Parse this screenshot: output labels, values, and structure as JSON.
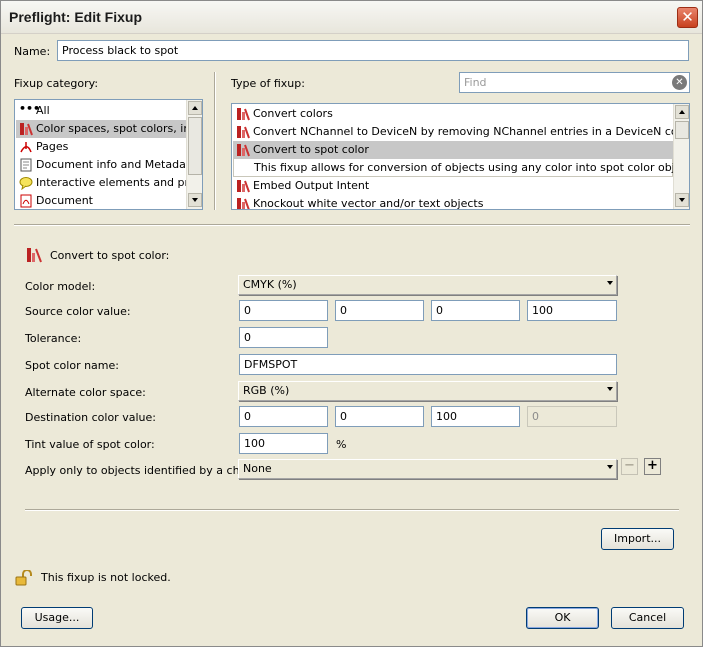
{
  "window": {
    "title": "Preflight: Edit Fixup",
    "close_label": "✕"
  },
  "name_field": {
    "label": "Name:",
    "value": "Process black to spot"
  },
  "fixup_category": {
    "label": "Fixup category:",
    "items": [
      {
        "label": "All",
        "icon": "ellipsis-icon"
      },
      {
        "label": "Color spaces, spot colors, inks",
        "icon": "color-spaces-icon"
      },
      {
        "label": "Pages",
        "icon": "pdf-icon"
      },
      {
        "label": "Document info and Metadata",
        "icon": "document-info-icon"
      },
      {
        "label": "Interactive elements and prope",
        "icon": "comment-bubble-icon"
      },
      {
        "label": "Document",
        "icon": "pdf-document-icon"
      }
    ]
  },
  "type_of_fixup": {
    "label": "Type of fixup:",
    "search_placeholder": "Find",
    "items": [
      {
        "label": "Convert colors"
      },
      {
        "label": "Convert NChannel to DeviceN by removing NChannel entries in a DeviceN color space."
      },
      {
        "label": "Convert to spot color"
      },
      {
        "label": "This fixup allows for conversion of objects using any color into spot color objects."
      },
      {
        "label": "Embed Output Intent"
      },
      {
        "label": "Knockout white vector and/or text objects"
      }
    ]
  },
  "details": {
    "heading": "Convert to spot color:",
    "color_model": {
      "label": "Color model:",
      "value": "CMYK (%)"
    },
    "source_color": {
      "label": "Source color value:",
      "values": [
        "0",
        "0",
        "0",
        "100"
      ]
    },
    "tolerance": {
      "label": "Tolerance:",
      "value": "0"
    },
    "spot_name": {
      "label": "Spot color name:",
      "value": "DFMSPOT"
    },
    "alternate_space": {
      "label": "Alternate color space:",
      "value": "RGB (%)"
    },
    "destination_color": {
      "label": "Destination color value:",
      "values": [
        "0",
        "0",
        "100",
        "0"
      ]
    },
    "tint": {
      "label": "Tint value of spot color:",
      "value": "100",
      "unit": "%"
    },
    "apply_only": {
      "label": "Apply only to objects identified by a check:",
      "value": "None",
      "minus": "−",
      "plus": "+"
    }
  },
  "buttons": {
    "import": "Import...",
    "usage": "Usage...",
    "ok": "OK",
    "cancel": "Cancel"
  },
  "lock_status": "This fixup is not locked."
}
